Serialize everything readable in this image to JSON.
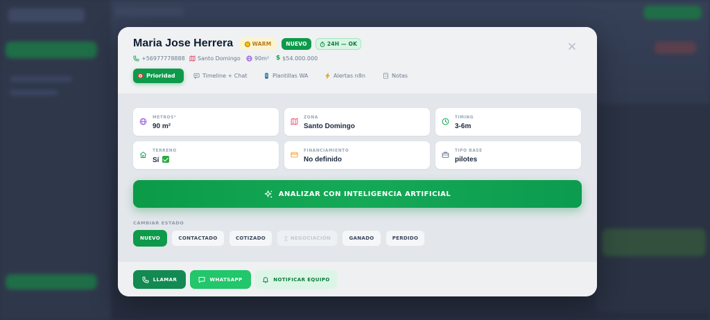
{
  "lead": {
    "name": "Maria Jose Herrera",
    "badges": {
      "temperature": "WARM",
      "status": "NUEVO",
      "sla": "24H — OK"
    },
    "meta": {
      "phone": "+56977778888",
      "location": "Santo Domingo",
      "area": "90m²",
      "price": "$54.000.000"
    }
  },
  "tabs": [
    {
      "label": "Prioridad",
      "icon": "target-icon"
    },
    {
      "label": "Timeline + Chat",
      "icon": "chat-icon"
    },
    {
      "label": "Plantillas WA",
      "icon": "phone-icon"
    },
    {
      "label": "Alertas n8n",
      "icon": "lightning-icon"
    },
    {
      "label": "Notas",
      "icon": "memo-icon"
    }
  ],
  "fields": [
    {
      "label": "METROS²",
      "value": "90 m²",
      "icon": "globe-icon"
    },
    {
      "label": "ZONA",
      "value": "Santo Domingo",
      "icon": "map-icon"
    },
    {
      "label": "TIMING",
      "value": "3-6m",
      "icon": "clock-icon"
    },
    {
      "label": "TERRENO",
      "value": "Sí",
      "icon": "home-icon"
    },
    {
      "label": "FINANCIAMIENTO",
      "value": "No definido",
      "icon": "credit-card-icon"
    },
    {
      "label": "TIPO BASE",
      "value": "pilotes",
      "icon": "briefcase-icon"
    }
  ],
  "ai_button": "ANALIZAR CON INTELIGENCIA ARTIFICIAL",
  "states": {
    "label": "CAMBIAR ESTADO",
    "options": [
      "NUEVO",
      "CONTACTADO",
      "COTIZADO",
      "NEGOCIACIÓN",
      "GANADO",
      "PERDIDO"
    ],
    "selected": "NUEVO"
  },
  "footer": {
    "call": "LLAMAR",
    "whatsapp": "WHATSAPP",
    "notify": "NOTIFICAR EQUIPO"
  },
  "colors": {
    "primary": "#0e9a4a",
    "whatsapp": "#22c66b",
    "warm": "#b7791f"
  }
}
